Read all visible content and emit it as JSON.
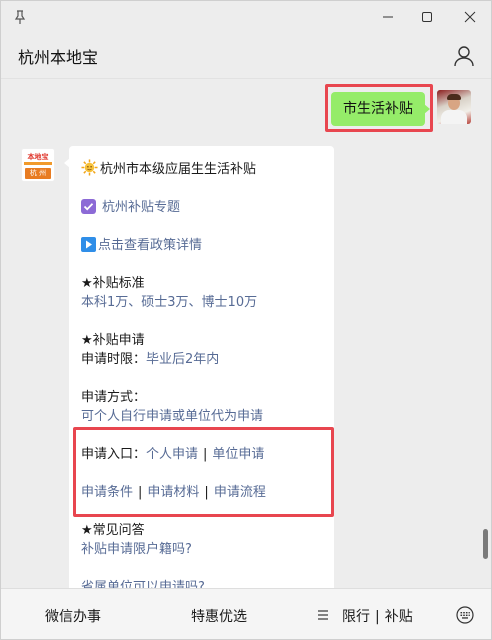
{
  "window": {
    "title_hidden": ""
  },
  "header": {
    "title": "杭州本地宝"
  },
  "chat": {
    "user_message": "市生活补贴",
    "bot_logo": {
      "top": "本地宝",
      "city": "杭 州"
    },
    "bot_message": {
      "title": "杭州市本级应届生生活补贴",
      "topic_link": "杭州补贴专题",
      "policy_link": "点击查看政策详情",
      "standard_heading": "★补贴标准",
      "standard_value": "本科1万、硕士3万、博士10万",
      "apply_heading": "★补贴申请",
      "apply_period_label": "申请时限：",
      "apply_period_value": "毕业后2年内",
      "apply_method_label": "申请方式：",
      "apply_method_value": "可个人自行申请或单位代为申请",
      "entry_label": "申请入口：",
      "entry_links": [
        "个人申请",
        "单位申请"
      ],
      "info_links": [
        "申请条件",
        "申请材料",
        "申请流程"
      ],
      "separator": "|",
      "faq_heading": "★常见问答",
      "faq_1": "补贴申请限户籍吗?",
      "faq_2": "省属单位可以申请吗?"
    }
  },
  "bottom_menu": {
    "item_1": "微信办事",
    "item_2": "特惠优选",
    "item_3a": "限行",
    "item_3_sep": "|",
    "item_3b": "补贴"
  },
  "colors": {
    "green_bubble": "#95ec69",
    "link": "#576b95",
    "highlight": "#e8464f"
  }
}
